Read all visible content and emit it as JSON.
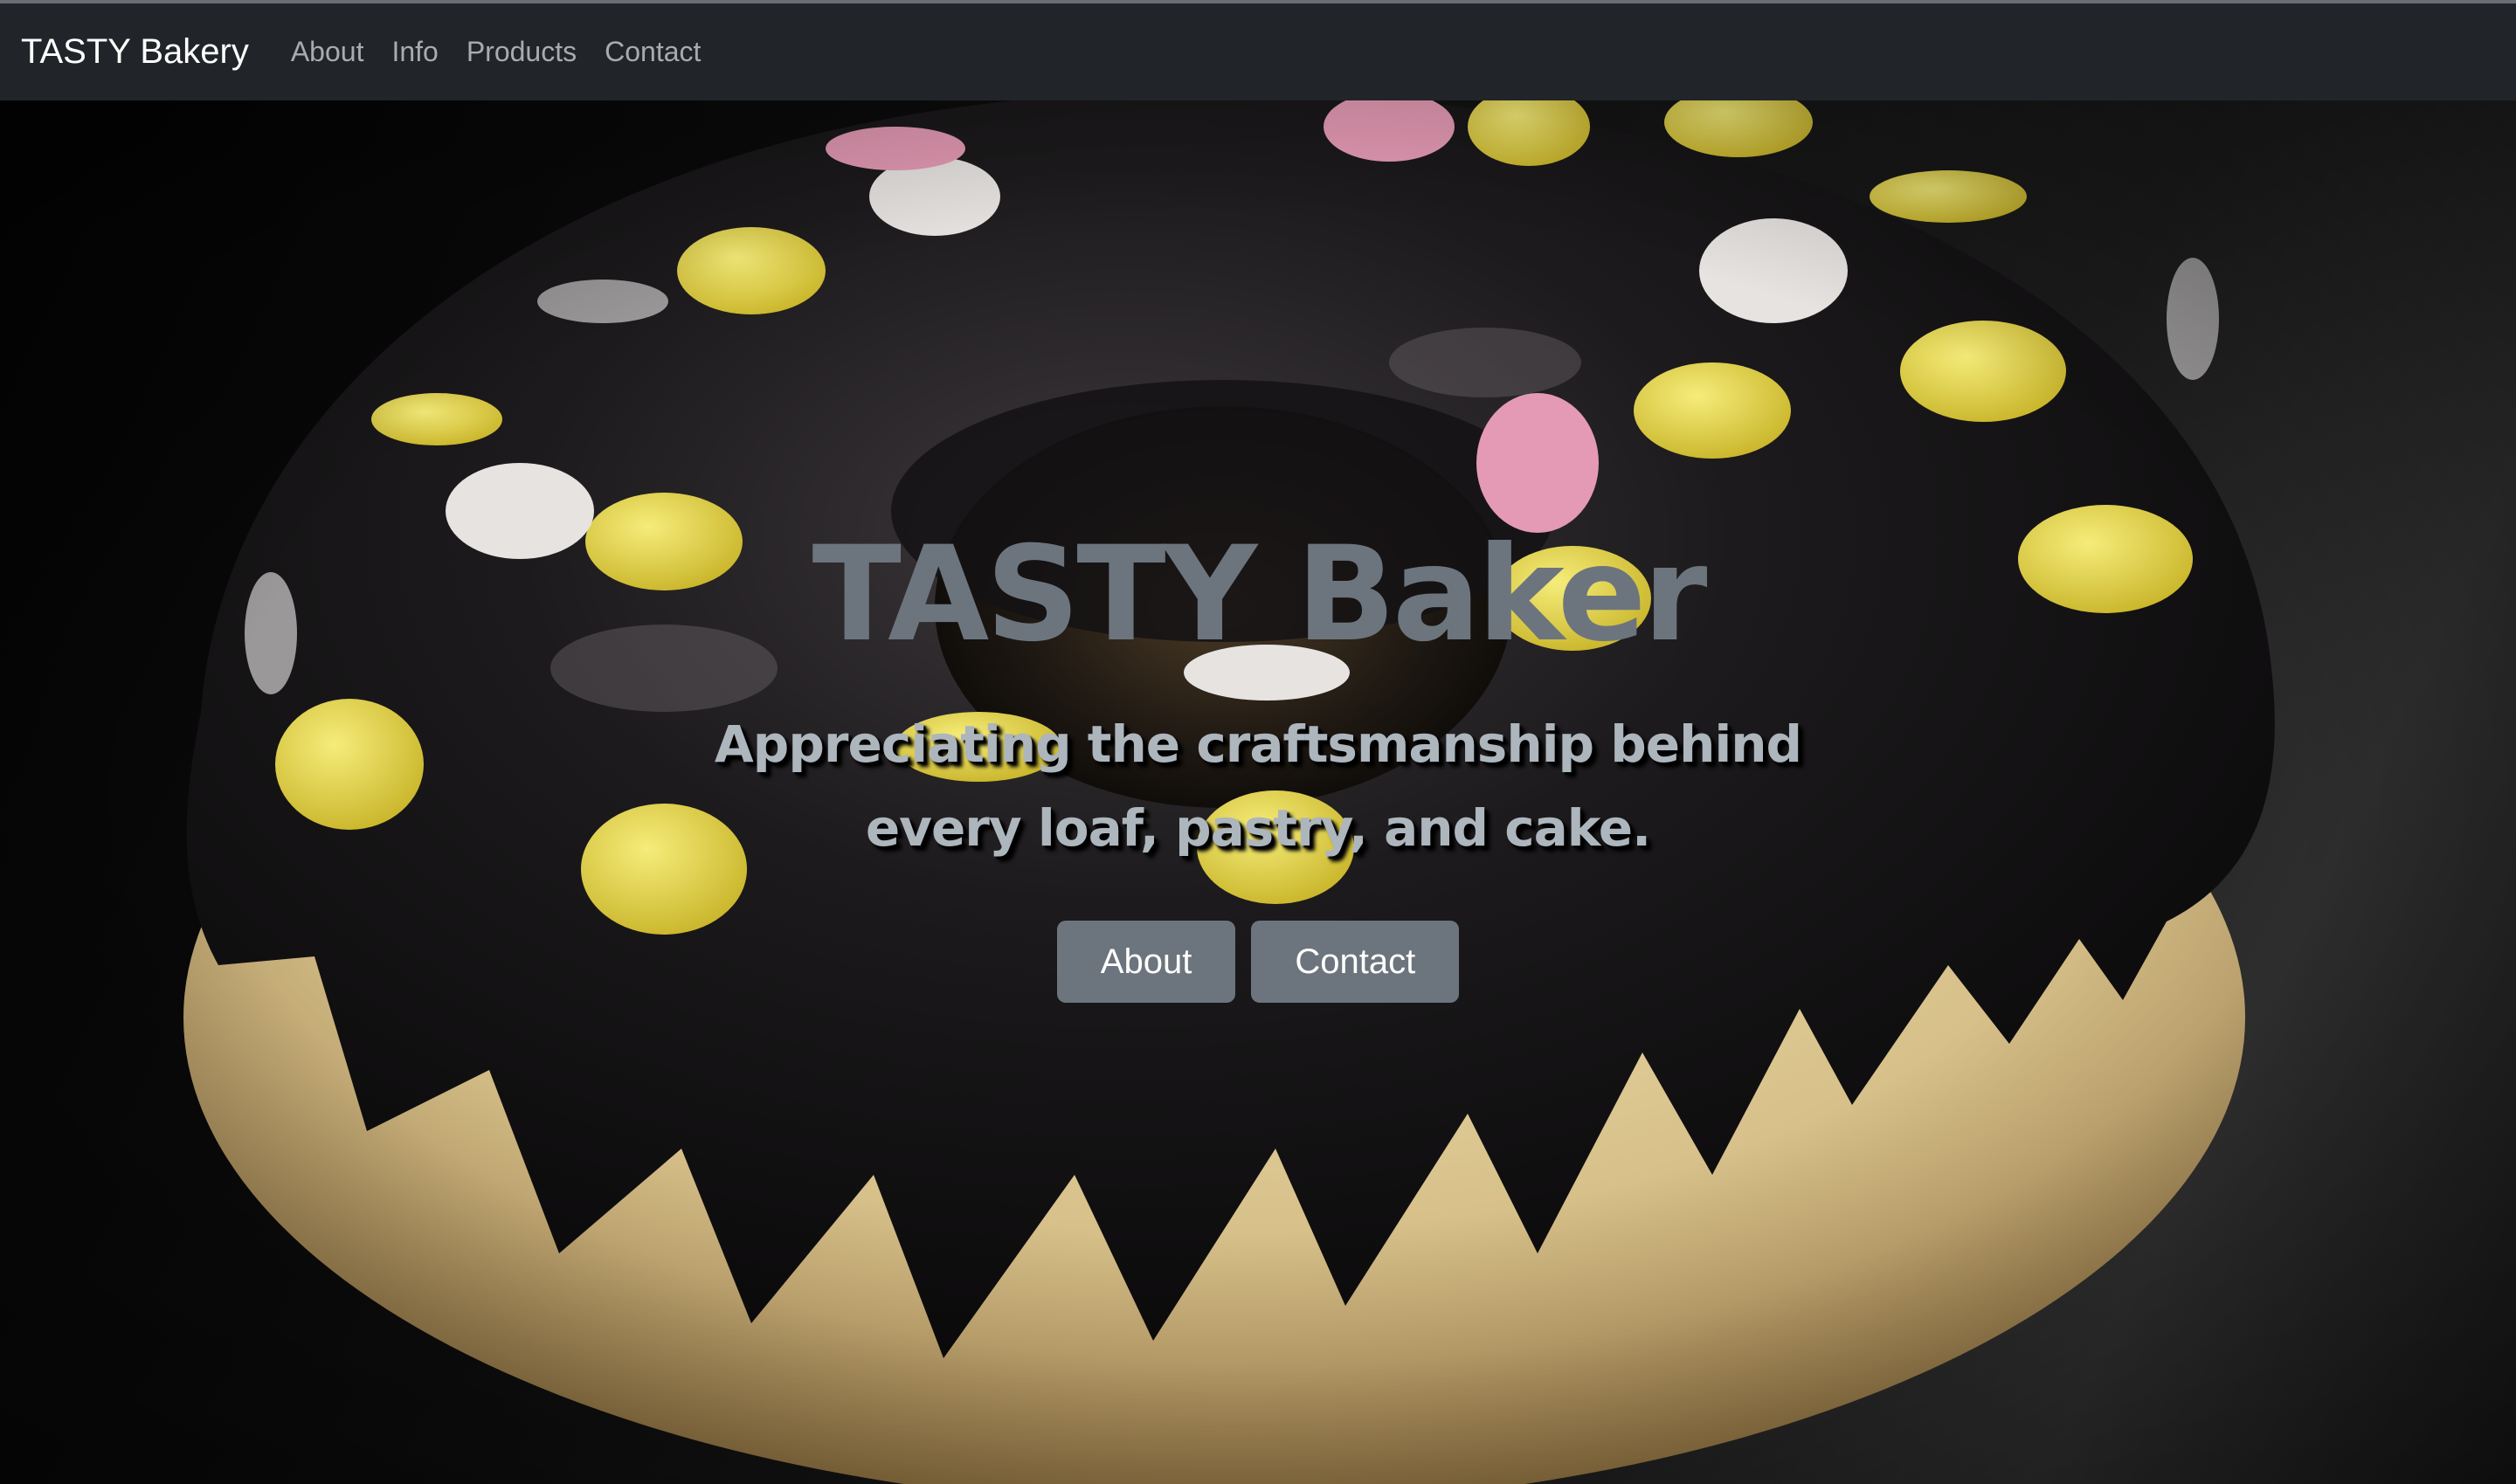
{
  "navbar": {
    "brand": "TASTY Bakery",
    "links": [
      {
        "label": "About"
      },
      {
        "label": "Info"
      },
      {
        "label": "Products"
      },
      {
        "label": "Contact"
      }
    ]
  },
  "hero": {
    "title": "TASTY Baker",
    "lead": "Appreciating the craftsmanship behind every loaf, pastry, and cake.",
    "buttons": [
      {
        "label": "About"
      },
      {
        "label": "Contact"
      }
    ],
    "background_image": "chocolate-glazed-donut-with-candy-sprinkles"
  },
  "colors": {
    "navbar_bg": "#212529",
    "nav_link": "#a8acb0",
    "button_bg": "#6c757d",
    "title": "#6c757d",
    "lead": "#adb5bd"
  }
}
